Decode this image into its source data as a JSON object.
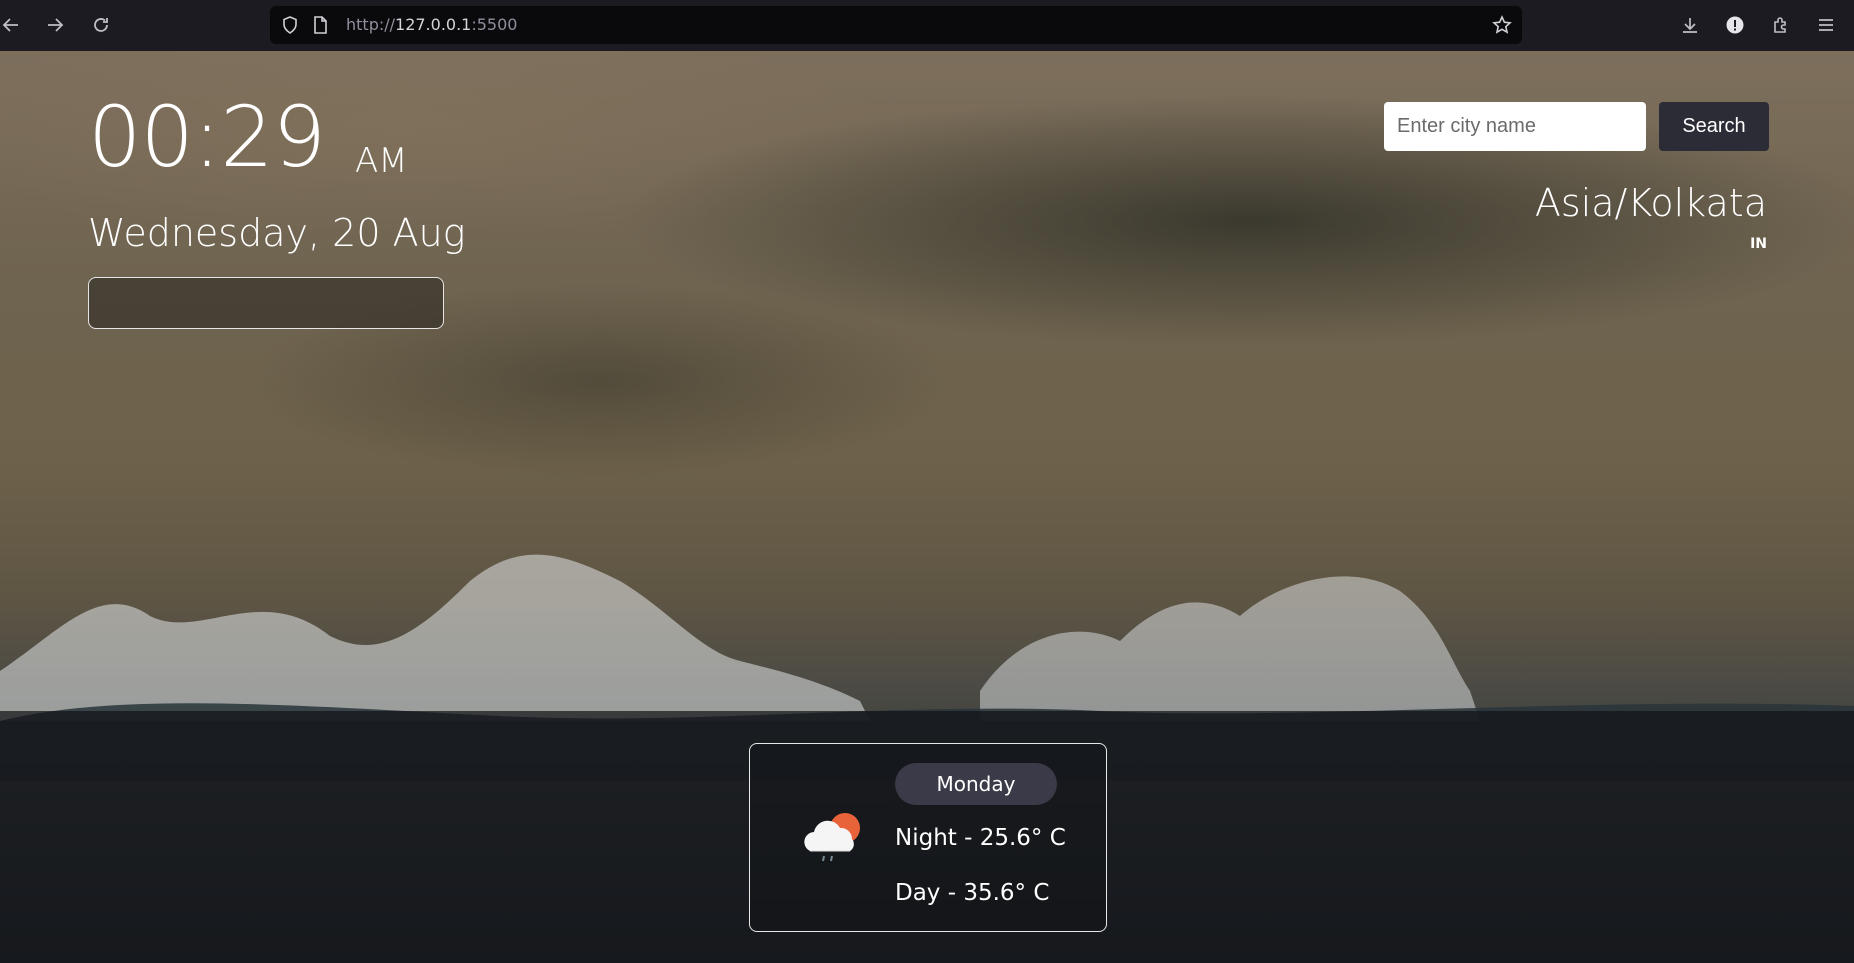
{
  "browser": {
    "url_prefix": "http://",
    "url_host": "127.0.0.1",
    "url_port": ":5500"
  },
  "clock": {
    "time": "00:29",
    "meridiem": "AM",
    "date": "Wednesday, 20 Aug"
  },
  "search": {
    "placeholder": "Enter city name",
    "value": "",
    "button_label": "Search"
  },
  "location": {
    "timezone": "Asia/Kolkata",
    "country": "IN"
  },
  "forecast": {
    "day": "Monday",
    "night": "Night - 25.6° C",
    "daytime": "Day - 35.6° C",
    "icon": "cloud-sun-rain-icon"
  },
  "colors": {
    "toolbar_bg": "#1c1b22",
    "search_button_bg": "#2c2c37",
    "day_pill_bg": "#3a3a48",
    "sun": "#e8633a"
  }
}
